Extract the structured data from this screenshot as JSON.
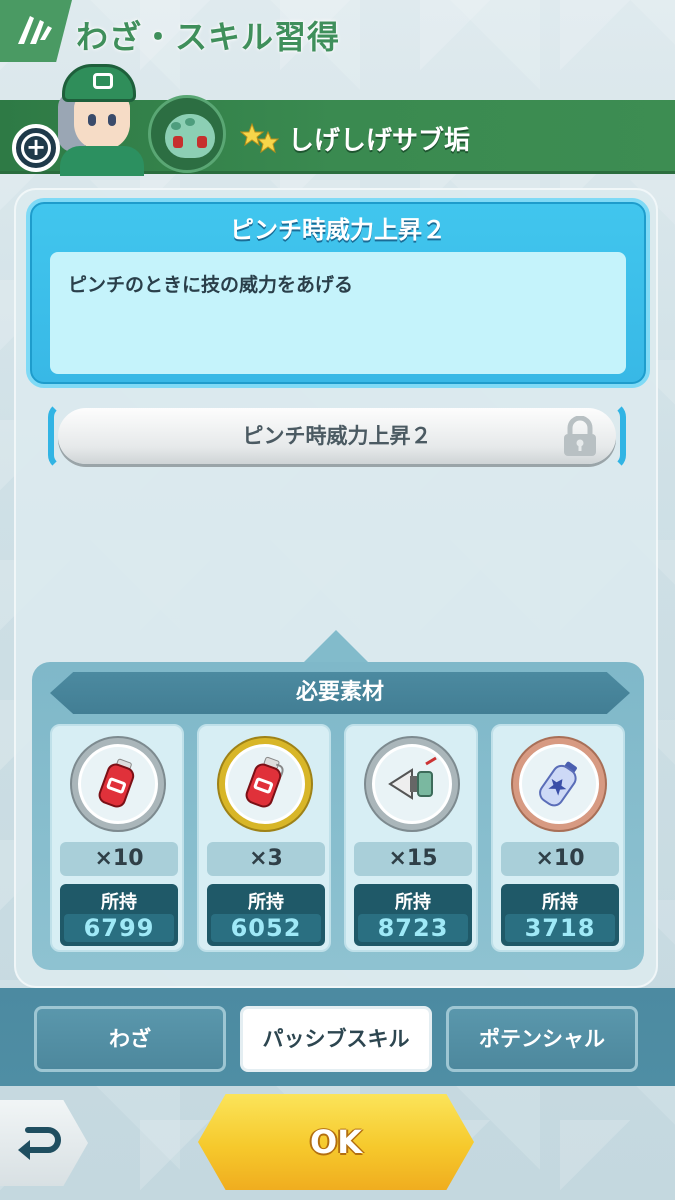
{
  "header": {
    "title": "わざ・スキル習得"
  },
  "sync_pair": {
    "name": "しげしげサブ垢"
  },
  "skill": {
    "title": "ピンチ時威力上昇２",
    "description": "ピンチのときに技の威力をあげる",
    "slot_label": "ピンチ時威力上昇２"
  },
  "materials": {
    "header": "必要素材",
    "owned_label": "所持",
    "items": [
      {
        "icon": "red-bottle-icon",
        "ring": "silver",
        "qty": "×10",
        "owned": "6799"
      },
      {
        "icon": "red-bottle-icon",
        "ring": "gold",
        "qty": "×3",
        "owned": "6052"
      },
      {
        "icon": "megaphone-icon",
        "ring": "silver",
        "qty": "×15",
        "owned": "8723"
      },
      {
        "icon": "blue-bottle-icon",
        "ring": "copper",
        "qty": "×10",
        "owned": "3718"
      }
    ]
  },
  "tabs": [
    {
      "label": "わざ",
      "active": false
    },
    {
      "label": "パッシブスキル",
      "active": true
    },
    {
      "label": "ポテンシャル",
      "active": false
    }
  ],
  "footer": {
    "ok_label": "OK"
  },
  "colors": {
    "accent_green": "#3f8f5b",
    "skill_blue": "#41c6ee",
    "ok_yellow": "#f6c92c"
  }
}
